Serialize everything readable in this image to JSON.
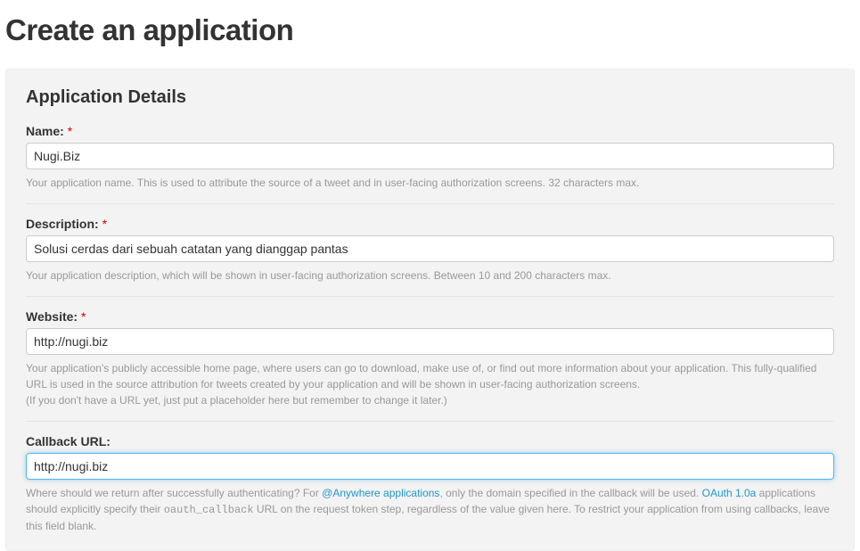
{
  "page": {
    "title": "Create an application"
  },
  "section": {
    "title": "Application Details"
  },
  "fields": {
    "name": {
      "label": "Name:",
      "required": "*",
      "value": "Nugi.Biz",
      "help": "Your application name. This is used to attribute the source of a tweet and in user-facing authorization screens. 32 characters max."
    },
    "description": {
      "label": "Description:",
      "required": "*",
      "value": "Solusi cerdas dari sebuah catatan yang dianggap pantas",
      "help": "Your application description, which will be shown in user-facing authorization screens. Between 10 and 200 characters max."
    },
    "website": {
      "label": "Website:",
      "required": "*",
      "value": "http://nugi.biz",
      "help1": "Your application's publicly accessible home page, where users can go to download, make use of, or find out more information about your application. This fully-qualified URL is used in the source attribution for tweets created by your application and will be shown in user-facing authorization screens.",
      "help2": "(If you don't have a URL yet, just put a placeholder here but remember to change it later.)"
    },
    "callback": {
      "label": "Callback URL:",
      "value": "http://nugi.biz",
      "help_pre": "Where should we return after successfully authenticating? For ",
      "help_link1": "@Anywhere applications",
      "help_mid1": ", only the domain specified in the callback will be used. ",
      "help_link2": "OAuth 1.0a",
      "help_mid2": " applications should explicitly specify their ",
      "help_code": "oauth_callback",
      "help_post": " URL on the request token step, regardless of the value given here. To restrict your application from using callbacks, leave this field blank."
    }
  }
}
